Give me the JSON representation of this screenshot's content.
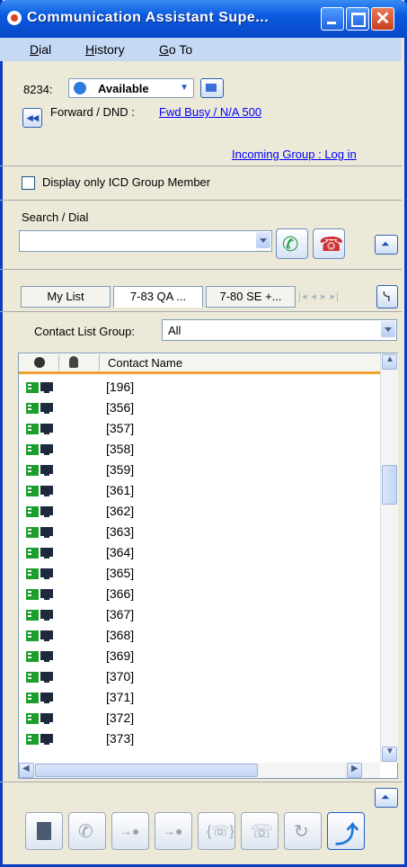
{
  "window": {
    "title": "Communication Assistant Supe..."
  },
  "menu": {
    "items": [
      {
        "label": "Dial"
      },
      {
        "label": "History"
      },
      {
        "label": "Go To"
      }
    ]
  },
  "status": {
    "extension_label": "8234:",
    "presence_value": "Available",
    "forward_label": "Forward / DND :",
    "forward_link": "Fwd Busy / N/A 500",
    "incoming_group_link": "Incoming Group : Log in"
  },
  "filter": {
    "display_only_icd_label": "Display only ICD Group Member",
    "checked": false
  },
  "search": {
    "label": "Search / Dial",
    "value": ""
  },
  "tabs": [
    {
      "label": "My List"
    },
    {
      "label": "7-83 QA ..."
    },
    {
      "label": "7-80 SE +..."
    }
  ],
  "contact_group": {
    "label": "Contact List Group:",
    "value": "All"
  },
  "list": {
    "header": {
      "name_column": "Contact Name"
    },
    "rows": [
      "[196]",
      "[356]",
      "[357]",
      "[358]",
      "[359]",
      "[361]",
      "[362]",
      "[363]",
      "[364]",
      "[365]",
      "[366]",
      "[367]",
      "[368]",
      "[369]",
      "[370]",
      "[371]",
      "[372]",
      "[373]"
    ]
  },
  "colors": {
    "titlebar": "#0a5ae0",
    "menubar": "#c5d9f5",
    "panel": "#ece9d8",
    "link": "#0000ff",
    "header_accent": "#f0a030"
  }
}
